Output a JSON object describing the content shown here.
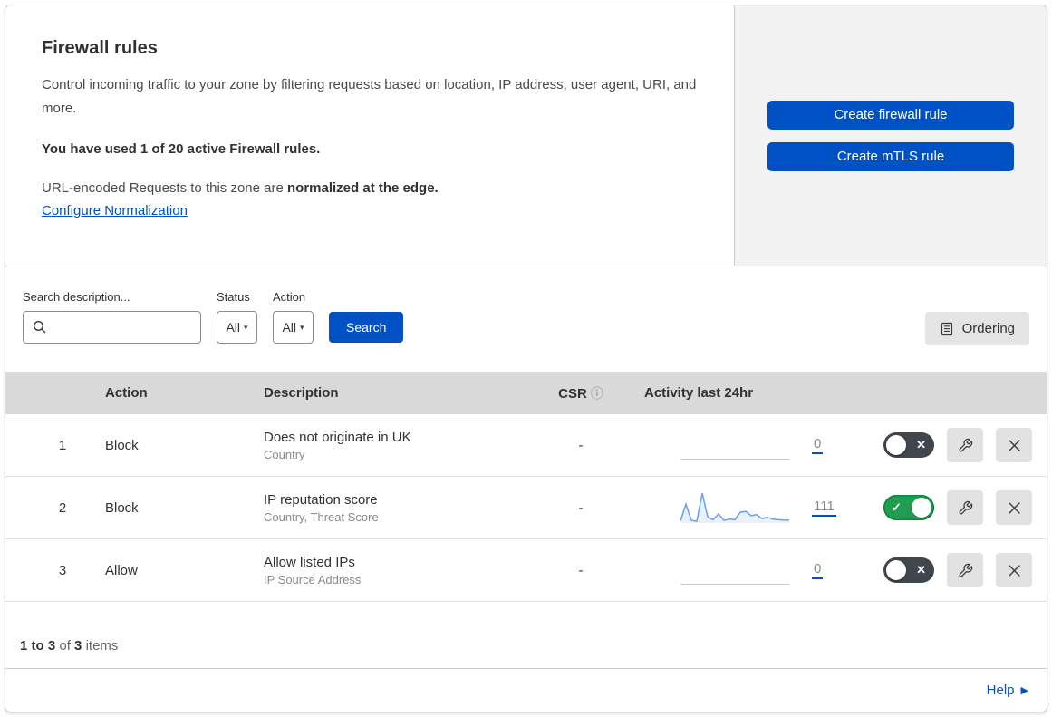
{
  "header": {
    "title": "Firewall rules",
    "description": "Control incoming traffic to your zone by filtering requests based on location, IP address, user agent, URI, and more.",
    "usage_notice": "You have used 1 of 20 active Firewall rules.",
    "normalization_text": "URL-encoded Requests to this zone are",
    "normalization_bold": "normalized at the edge.",
    "normalization_link": "Configure Normalization"
  },
  "actions_panel": {
    "create_firewall_rule": "Create firewall rule",
    "create_mtls_rule": "Create mTLS rule"
  },
  "filters": {
    "search_label": "Search description...",
    "status_label": "Status",
    "status_value": "All",
    "action_label": "Action",
    "action_value": "All",
    "search_button": "Search",
    "ordering_button": "Ordering"
  },
  "table": {
    "headers": {
      "action": "Action",
      "description": "Description",
      "csr": "CSR",
      "csr_info_icon": "info-icon",
      "activity": "Activity last 24hr"
    },
    "rows": [
      {
        "priority": "1",
        "action": "Block",
        "description": "Does not originate in UK",
        "match_fields": "Country",
        "csr": "-",
        "activity_count": "0",
        "enabled": false,
        "sparkline": null
      },
      {
        "priority": "2",
        "action": "Block",
        "description": "IP reputation score",
        "match_fields": "Country, Threat Score",
        "csr": "-",
        "activity_count": "111",
        "enabled": true,
        "sparkline": [
          4,
          62,
          6,
          3,
          100,
          18,
          8,
          28,
          6,
          10,
          8,
          34,
          37,
          22,
          26,
          12,
          17,
          10,
          8,
          7,
          7
        ]
      },
      {
        "priority": "3",
        "action": "Allow",
        "description": "Allow listed IPs",
        "match_fields": "IP Source Address",
        "csr": "-",
        "activity_count": "0",
        "enabled": false,
        "sparkline": null
      }
    ]
  },
  "footer": {
    "range": "1 to 3",
    "of": "of",
    "total": "3",
    "items": "items"
  },
  "help": {
    "label": "Help"
  },
  "colors": {
    "accent": "#0051c3",
    "toggle_on": "#1f9e50",
    "toggle_off": "#40464d",
    "sparkline": "#6d9fe8",
    "table_header_bg": "#d9d9d9",
    "panel_bg": "#f2f2f2"
  }
}
